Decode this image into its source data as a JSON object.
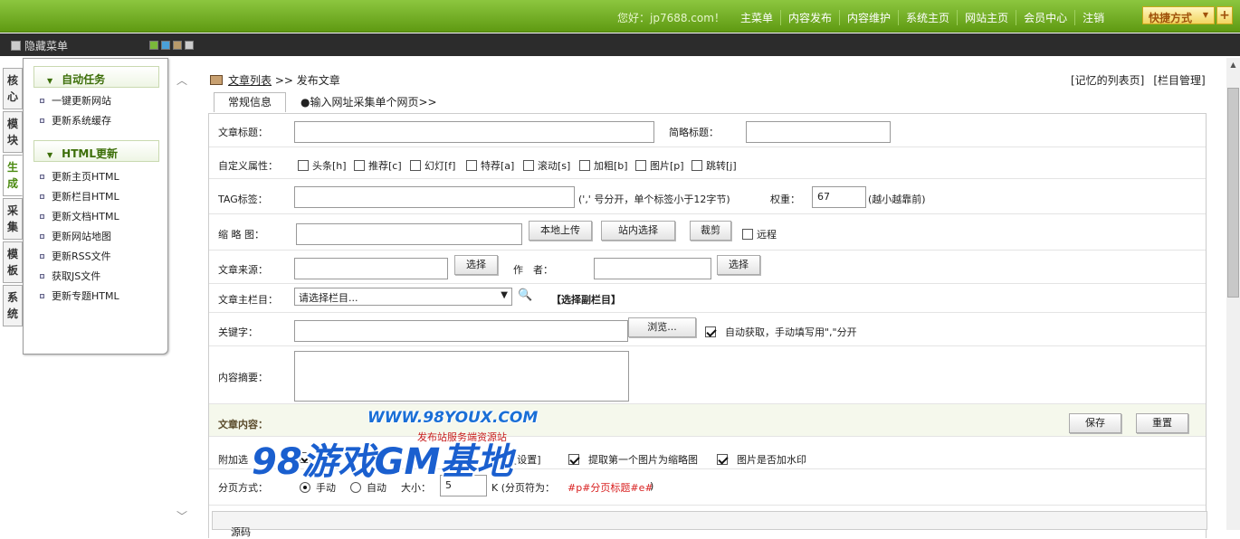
{
  "topbar": {
    "greeting": "您好：jp7688.com！",
    "nav": [
      "主菜单",
      "内容发布",
      "内容维护",
      "系统主页",
      "网站主页",
      "会员中心",
      "注销"
    ],
    "quick": "快捷方式",
    "plus": "+"
  },
  "darkbar": {
    "hide_menu": "隐藏菜单",
    "swatch_colors": [
      "#7ab83a",
      "#4aa0d8",
      "#b89a6a",
      "#cccccc"
    ]
  },
  "lefttabs": [
    "核心",
    "模块",
    "生成",
    "采集",
    "模板",
    "系统"
  ],
  "sidebar": {
    "sections": [
      {
        "title": "自动任务",
        "items": [
          "一键更新网站",
          "更新系统缓存"
        ]
      },
      {
        "title": "HTML更新",
        "items": [
          "更新主页HTML",
          "更新栏目HTML",
          "更新文档HTML",
          "更新网站地图",
          "更新RSS文件",
          "获取JS文件",
          "更新专题HTML"
        ]
      }
    ]
  },
  "breadcrumb": {
    "link": "文章列表",
    "sep": ">>",
    "current": "发布文章"
  },
  "rightlinks": [
    "[记忆的列表页]",
    "[栏目管理]"
  ],
  "tabs": {
    "tab1": "常规信息",
    "tab2": "●输入网址采集单个网页>>"
  },
  "form": {
    "title_label": "文章标题：",
    "short_title_label": "简略标题：",
    "attr_label": "自定义属性：",
    "attrs": [
      "头条[h]",
      "推荐[c]",
      "幻灯[f]",
      "特荐[a]",
      "滚动[s]",
      "加粗[b]",
      "图片[p]",
      "跳转[j]"
    ],
    "tag_label": "TAG标签：",
    "tag_hint": "(',' 号分开，单个标签小于12字节)",
    "weight_label": "权重：",
    "weight_value": "67",
    "weight_hint": "(越小越靠前)",
    "thumb_label": "缩 略 图：",
    "upload_btn": "本地上传",
    "site_select_btn": "站内选择",
    "crop_btn": "裁剪",
    "remote_label": "远程",
    "source_label": "文章来源：",
    "select_btn": "选择",
    "author_label": "作　者：",
    "column_label": "文章主栏目：",
    "column_placeholder": "请选择栏目...",
    "sub_column_link": "【选择副栏目】",
    "keywords_label": "关键字：",
    "browse_btn": "浏览...",
    "auto_keywords": "自动获取，手动填写用\",\"分开",
    "summary_label": "内容摘要：",
    "content_label": "文章内容：",
    "save_btn": "保存",
    "reset_btn": "重置",
    "extra_label": "附加选",
    "extra_settings": "[设置]",
    "extract_first_img": "提取第一个图片为缩略图",
    "watermark_opt": "图片是否加水印",
    "paging_label": "分页方式：",
    "paging_manual": "手动",
    "paging_auto": "自动",
    "size_label": "大小：",
    "size_value": "5",
    "size_unit": "K (分页符为：",
    "page_marker": "#p#分页标题#e#",
    "size_close": ")",
    "editor_source": "源码"
  },
  "watermark": {
    "url": "WWW.98YOUX.COM",
    "sub": "发布站服务端资源站",
    "big": "98游戏GM基地"
  }
}
